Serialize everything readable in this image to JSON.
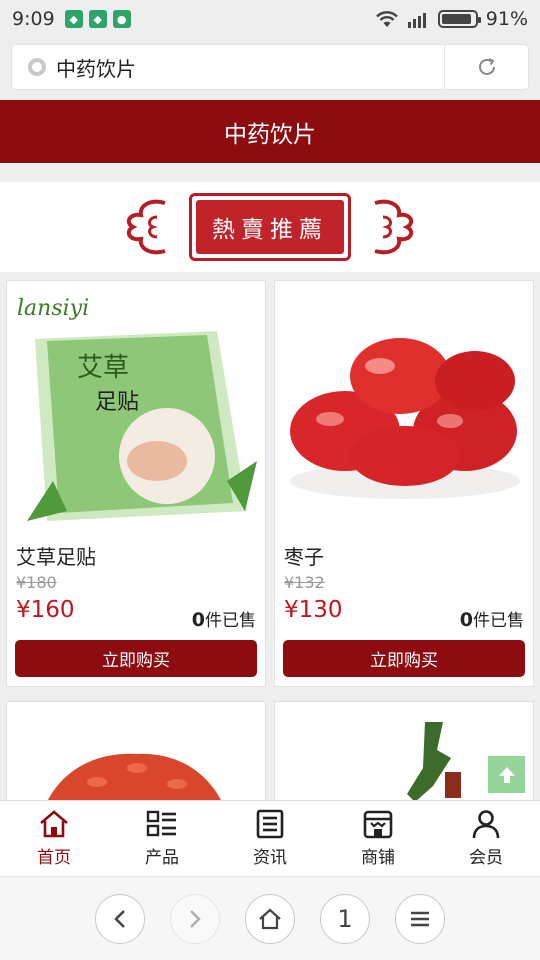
{
  "status_bar": {
    "time": "9:09",
    "battery": "91%",
    "battery_level": 0.91
  },
  "address_bar": {
    "url_text": "中药饮片"
  },
  "header": {
    "title": "中药饮片"
  },
  "banner": {
    "text": "熱賣推薦"
  },
  "products": [
    {
      "name": "艾草足贴",
      "original_price": "¥180",
      "price": "¥160",
      "sold_count": "0",
      "sold_suffix": "件已售",
      "buy_label": "立即购买",
      "image_text": "lansiyi"
    },
    {
      "name": "枣子",
      "original_price": "¥132",
      "price": "¥130",
      "sold_count": "0",
      "sold_suffix": "件已售",
      "buy_label": "立即购买"
    }
  ],
  "bottom_nav": [
    {
      "label": "首页",
      "icon": "home-icon",
      "active": true
    },
    {
      "label": "产品",
      "icon": "list-icon",
      "active": false
    },
    {
      "label": "资讯",
      "icon": "news-icon",
      "active": false
    },
    {
      "label": "商铺",
      "icon": "shop-icon",
      "active": false
    },
    {
      "label": "会员",
      "icon": "user-icon",
      "active": false
    }
  ],
  "browser_controls": {
    "tab_count": "1"
  },
  "colors": {
    "primary": "#8c0c0f",
    "price_red": "#c4151c",
    "to_top_green": "#95d59a"
  }
}
